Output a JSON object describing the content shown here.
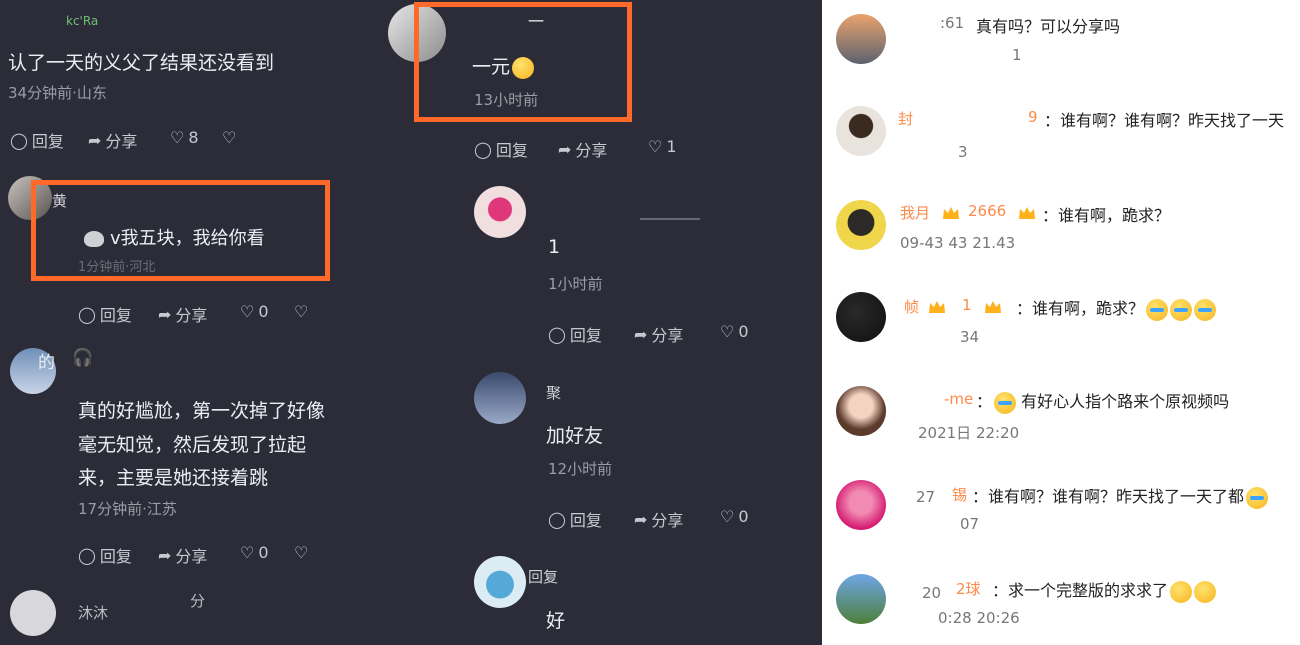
{
  "left_panel": {
    "comments": [
      {
        "name": "kc'Ra",
        "text": "认了一天的义父了结果还没看到",
        "meta": "34分钟前·山东",
        "reply": "回复",
        "share": "分享",
        "likes": "8"
      },
      {
        "name": "黄",
        "text": "v我五块，我给你看",
        "meta": "1分钟前·河北",
        "reply": "回复",
        "share": "分享",
        "likes": "0"
      },
      {
        "name": "的",
        "text_lines": [
          "真的好尴尬，第一次掉了好像",
          "毫无知觉，然后发现了拉起",
          "来，主要是她还接着跳"
        ],
        "meta": "17分钟前·江苏",
        "reply": "回复",
        "share": "分享",
        "likes": "0"
      },
      {
        "name": "沐沐",
        "text": "分",
        "meta": ""
      }
    ],
    "right_column": [
      {
        "name": "一",
        "text": "一元",
        "meta": "13小时前",
        "reply": "回复",
        "share": "分享",
        "likes": "1"
      },
      {
        "name": "________",
        "text": "1",
        "meta": "1小时前",
        "reply": "回复",
        "share": "分享",
        "likes": "0"
      },
      {
        "name": "聚",
        "text": "加好友",
        "meta": "12小时前",
        "reply": "回复",
        "share": "分享",
        "likes": "0"
      },
      {
        "name": "回复",
        "text": "好",
        "meta": ""
      }
    ]
  },
  "right_panel": {
    "comments": [
      {
        "name": ":61",
        "text": "真有吗？可以分享吗",
        "meta": "1"
      },
      {
        "name": "封",
        "id": "9",
        "text": "：谁有啊？谁有啊？昨天找了一天",
        "meta": "3"
      },
      {
        "name": "我月",
        "id": "2666",
        "text": "：谁有啊，跪求？",
        "meta": "09-43 43 21.43"
      },
      {
        "name": "帧",
        "id": "1",
        "text": "：谁有啊，跪求？",
        "meta": "34"
      },
      {
        "name": "-me",
        "text": "有好心人指个路来个原视频吗",
        "meta": "2021日 22:20"
      },
      {
        "name": "锡",
        "id": "27",
        "text": "：谁有啊？谁有啊？昨天找了一天了都",
        "meta": "07"
      },
      {
        "name": "2球",
        "id": "20",
        "text": "：求一个完整版的求求了",
        "meta": "0:28 20:26"
      }
    ]
  },
  "colors": {
    "dark_bg": "#2b2c38",
    "highlight": "#ff6a2b",
    "name_orange": "#ff8a4a"
  }
}
